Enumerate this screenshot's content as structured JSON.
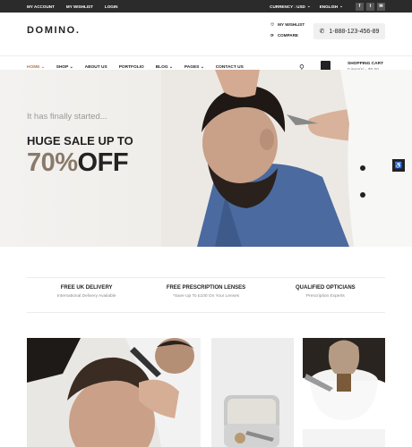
{
  "topbar": {
    "links": [
      "MY ACCOUNT",
      "MY WISHLIST",
      "LOGIN"
    ],
    "currency": "CURRENCY : USD",
    "language": "ENGLISH",
    "social": [
      "facebook-icon",
      "twitter-icon",
      "email-icon"
    ]
  },
  "header": {
    "logo": "DOMINO.",
    "wishlist": "MY WISHLIST",
    "compare": "COMPARE",
    "phone": "1-888-123-456-89"
  },
  "nav": {
    "items": [
      "HOME",
      "SHOP",
      "ABOUT US",
      "PORTFOLIO",
      "BLOG",
      "PAGES",
      "CONTACT US"
    ],
    "active": "HOME",
    "cart_title": "SHOPPING CART",
    "cart_summary": "0 item(s) - $0.00"
  },
  "hero": {
    "subtitle": "It has finally started...",
    "headline": "HUGE SALE UP TO",
    "percent": "70%",
    "off": "OFF"
  },
  "features": [
    {
      "title": "FREE UK DELIVERY",
      "subtitle": "International Delivery Available"
    },
    {
      "title": "FREE PRESCRIPTION LENSES",
      "subtitle": "*Save Up To £100 On Your Lenses"
    },
    {
      "title": "QUALIFIED OPTICIANS",
      "subtitle": "Prescription Experts"
    }
  ],
  "colors": {
    "accent": "#b07a4a",
    "percent": "#8a7a6a",
    "topbar": "#2b2b2b"
  }
}
